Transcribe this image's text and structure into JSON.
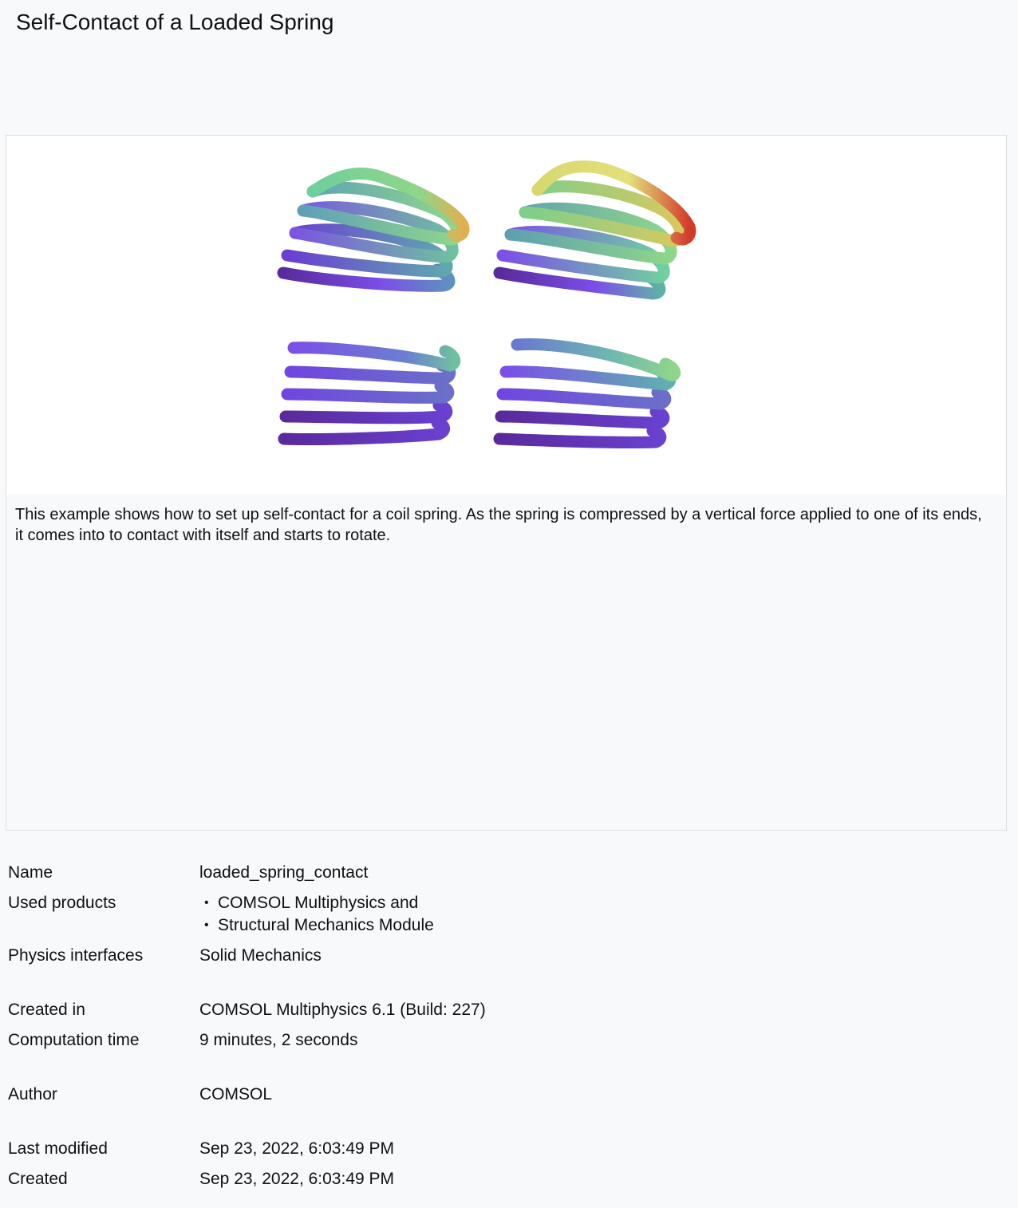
{
  "page": {
    "title": "Self-Contact of a Loaded Spring"
  },
  "preview": {
    "description": "This example shows how to set up self-contact for a coil spring. As the spring is compressed by a vertical force applied to one of its ends, it comes into to contact with itself and starts to rotate."
  },
  "info": {
    "name_label": "Name",
    "name_value": "loaded_spring_contact",
    "used_products_label": "Used products",
    "used_products": [
      "COMSOL Multiphysics and",
      "Structural Mechanics Module"
    ],
    "physics_label": "Physics interfaces",
    "physics_value": "Solid Mechanics",
    "created_in_label": "Created in",
    "created_in_value": "COMSOL Multiphysics 6.1 (Build: 227)",
    "computation_label": "Computation time",
    "computation_value": "9 minutes, 2 seconds",
    "author_label": "Author",
    "author_value": "COMSOL",
    "last_modified_label": "Last modified",
    "last_modified_value": "Sep 23, 2022, 6:03:49 PM",
    "created_label": "Created",
    "created_value": "Sep 23, 2022, 6:03:49 PM"
  },
  "colors": {
    "coil_low": "#5a2a9c",
    "coil_mid": "#7b4fe8",
    "coil_teal": "#5fb0a8",
    "coil_green": "#8fd68a",
    "coil_yellow": "#e4e07a",
    "coil_red": "#d23a2a"
  }
}
